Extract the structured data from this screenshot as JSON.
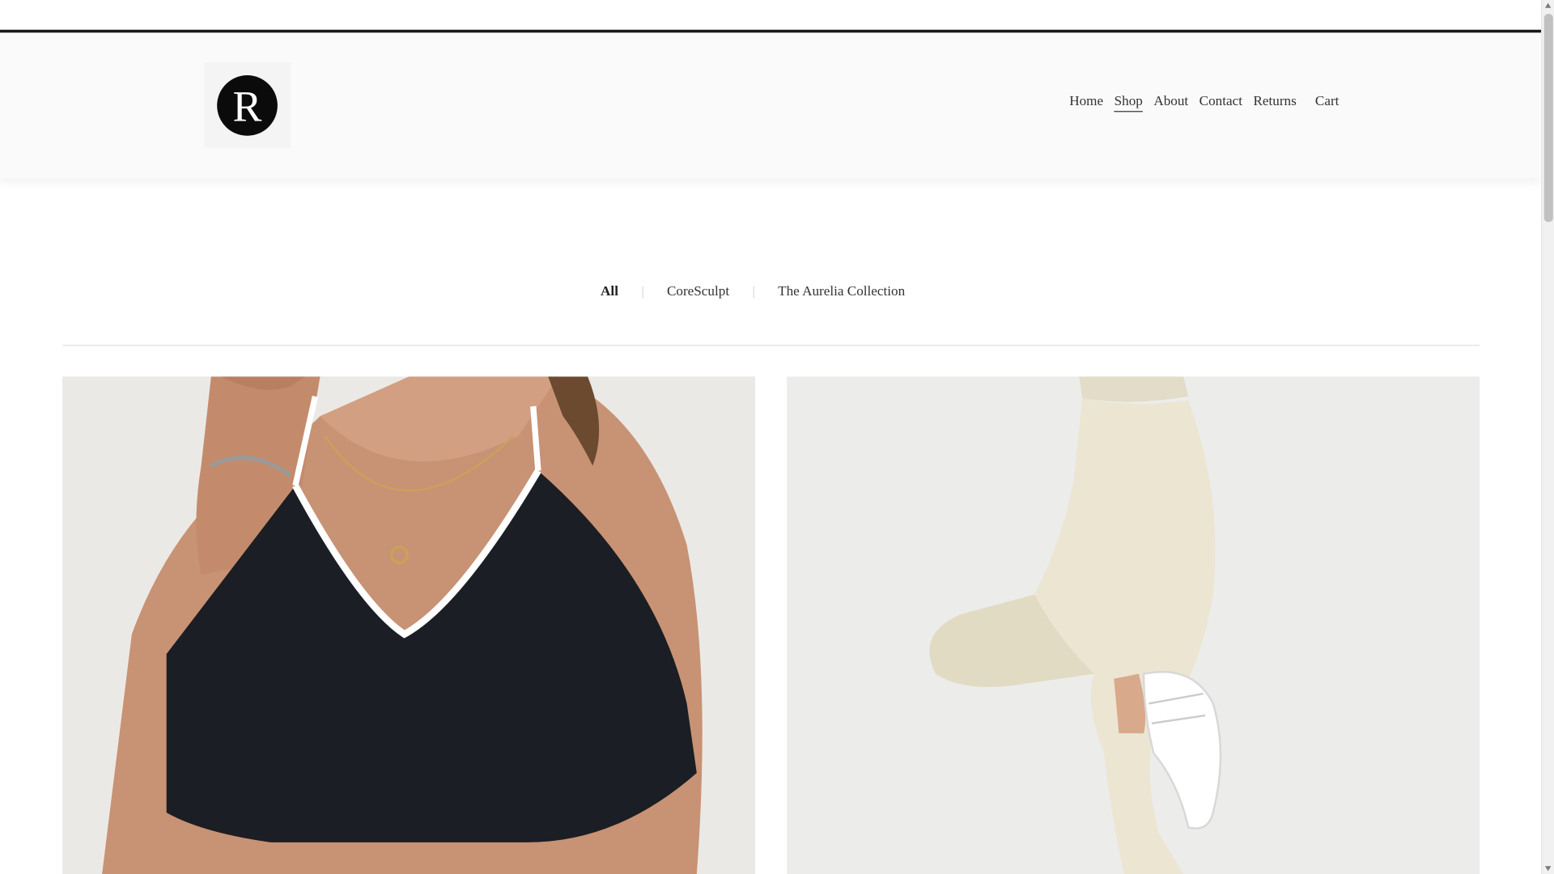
{
  "logo": {
    "letter": "R"
  },
  "nav": {
    "items": [
      {
        "label": "Home",
        "active": false
      },
      {
        "label": "Shop",
        "active": true
      },
      {
        "label": "About",
        "active": false
      },
      {
        "label": "Contact",
        "active": false
      },
      {
        "label": "Returns",
        "active": false
      }
    ],
    "cart_label": "Cart"
  },
  "filters": {
    "items": [
      {
        "label": "All",
        "active": true
      },
      {
        "label": "CoreSculpt",
        "active": false
      },
      {
        "label": "The Aurelia Collection",
        "active": false
      }
    ]
  },
  "products": [
    {
      "image": "black sports bra with white trim"
    },
    {
      "image": "cream high-waisted leggings"
    }
  ],
  "colors": {
    "logo_bg": "#0b0b0b",
    "header_bg": "#fafafa",
    "bra": "#1b1e24",
    "trim": "#ffffff",
    "skin": "#c89274",
    "leggings": "#ebe5d2"
  }
}
